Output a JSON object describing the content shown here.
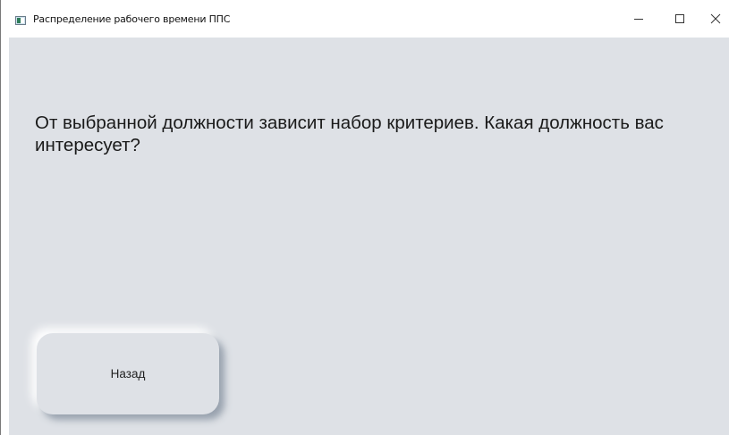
{
  "window": {
    "title": "Распределение рабочего времени ППС",
    "icon": "app-window-icon",
    "controls": {
      "minimize_icon": "minimize-icon",
      "maximize_icon": "maximize-icon",
      "close_icon": "close-icon"
    }
  },
  "main": {
    "question": "От выбранной должности зависит набор критериев. Какая должность вас интересует?",
    "back_button_label": "Назад"
  },
  "colors": {
    "background": "#dee1e6",
    "titlebar": "#ffffff",
    "text": "#1a1a1a"
  }
}
